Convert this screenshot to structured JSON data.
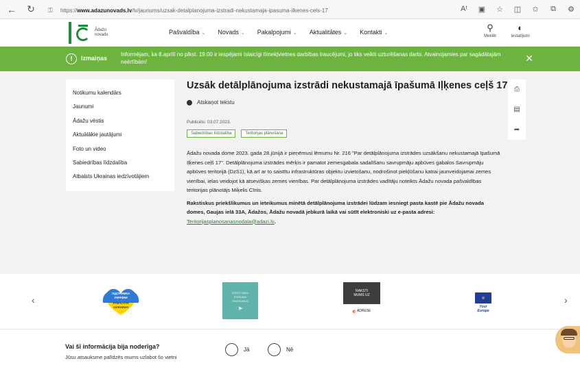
{
  "browser": {
    "url_prefix": "https://",
    "url_host": "www.adazunovads.lv",
    "url_path": "/lv/jaunums/uzsak-detalplanojuma-izstradi-nekustamaja-ipasuma-ilkenes-cels-17"
  },
  "header": {
    "logo_line1": "Ādažu",
    "logo_line2": "novads",
    "nav": [
      {
        "label": "Pašvaldība"
      },
      {
        "label": "Novads"
      },
      {
        "label": "Pakalpojumi"
      },
      {
        "label": "Aktualitātes"
      },
      {
        "label": "Kontakti"
      }
    ],
    "search_label": "Meklēt",
    "settings_label": "Iestatījumi"
  },
  "alert": {
    "title": "Izmaiņas",
    "text": "Informējam, ka 8.aprīlī no plkst. 19.00 ir iespējami īslaicīgi tīmekļvietnes darbības traucējumi, jo tiks veikti uzturēšanas darbi. Atvainojamies par sagādātajām neērtībām!"
  },
  "sidebar": {
    "items": [
      {
        "label": "Notikumu kalendārs"
      },
      {
        "label": "Jaunumi"
      },
      {
        "label": "Ādažu vēstis"
      },
      {
        "label": "Aktuālākie jautājumi"
      },
      {
        "label": "Foto un video"
      },
      {
        "label": "Sabiedrības līdzdalība"
      },
      {
        "label": "Atbalsts Ukrainas iedzīvotājiem"
      }
    ]
  },
  "article": {
    "title": "Uzsāk detālplānojuma izstrādi nekustamajā īpašumā Iļķenes ceļš 17",
    "tts_label": "Atskaņot tekstu",
    "published": "Publicēts: 03.07.2023.",
    "tags": [
      "Sabiedrības līdzdalība",
      "Teritorijas plānošana"
    ],
    "paragraph1": "Ādažu novada dome 2023. gada 28.jūnijā ir pieņēmusi lēmumu Nr. 216 \"Par detālplānojuma izstrādes uzsākšanu nekustamajā īpašumā Iļķenes ceļš 17\". Detālplānojuma izstrādes mērķis ir pamatot zemesgabala sadalīšanu savrupmāju apbūves gabalos Savrupmāju apbūves teritorijā (DzS1), kā arī ar to saistītu infrastruktūras objektu izvietošanu, nodrošinot piekļūšanu katrai jaunveidojamai zemes vienībai, ielas veidojot kā atsevišķas zemes vienības. Par detālplānojuma izstrādes vadītāju noteikts Ādažu novada pašvaldības teritorijas plānotājs Miķelis Cīnis.",
    "paragraph2": "Rakstiskus priekšlikumus un ieteikumus minētā detālplānojuma izstrādei lūdzam iesniegt pasta kastē pie Ādažu novada domes, Gaujas ielā 33A, Ādažos, Ādažu novadā jebkurā laikā vai sūtīt elektroniski uz e-pasta",
    "address_label": "adresi:",
    "email": "Teritorijasplanosanasnodala@adazi.lv",
    "address_end": "."
  },
  "side_tools": [
    "print-icon",
    "pdf-icon",
    "share-icon"
  ],
  "partners": {
    "heart_text1": "ПІДТРИМКА",
    "heart_text2": "УКРАЇНИ",
    "heart_text3": "ATBALSTA",
    "heart_text4": "UKRAINAI",
    "p2_line1": "IESŪTI SAVA",
    "p2_line2": "ĪPAŠUMA",
    "p2_line3": "RĀDĪJUMUS",
    "p3_line1": "RAKSTI",
    "p3_line2": "MUMS UZ",
    "p3_logo": "e",
    "p3_brand": "ADRESE",
    "p4_line1": "Your",
    "p4_line2": "Europe"
  },
  "feedback": {
    "question": "Vai šī informācija bija noderīga?",
    "subtitle": "Jūsu atsauksme palīdzēs mums uzlabot šo vietni",
    "yes": "Jā",
    "no": "Nē"
  },
  "colors": {
    "brand_green": "#1e8c3b",
    "alert_green": "#6db33f",
    "link_green": "#2e7d32"
  }
}
